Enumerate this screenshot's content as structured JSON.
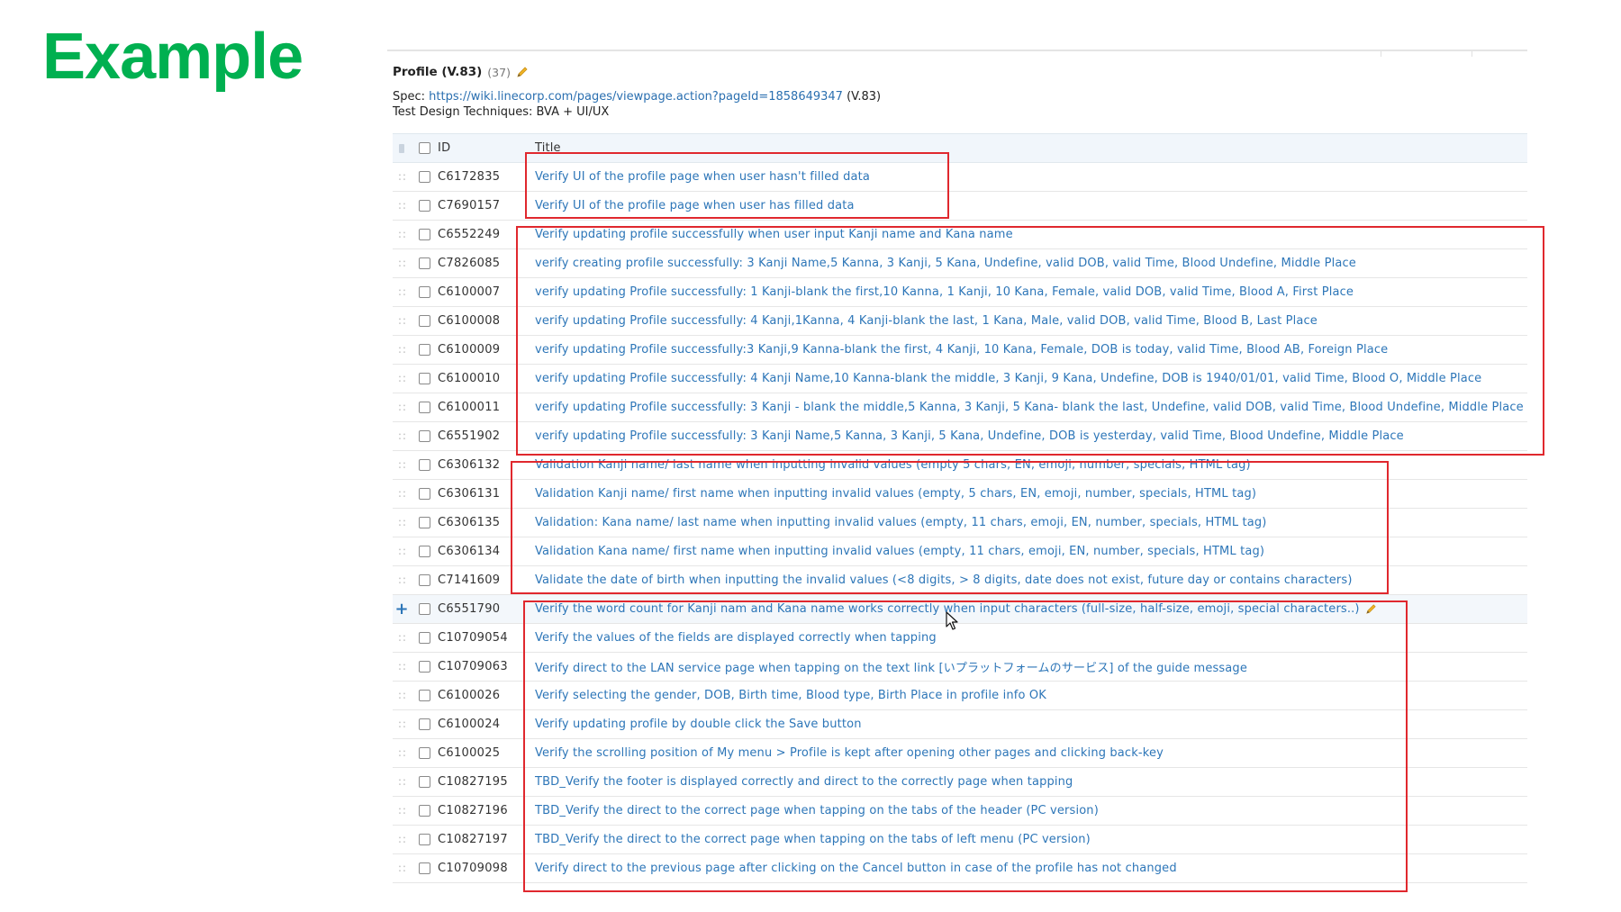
{
  "slide": {
    "title": "Example"
  },
  "section": {
    "name": "Profile (V.83)",
    "count": "(37)",
    "spec_label": "Spec:",
    "spec_url": "https://wiki.linecorp.com/pages/viewpage.action?pageId=1858649347",
    "spec_version": "(V.83)",
    "techniques": "Test Design Techniques: BVA + UI/UX"
  },
  "table": {
    "columns": {
      "id": "ID",
      "title": "Title"
    },
    "rows": [
      {
        "id": "C6172835",
        "title": "Verify UI of the profile page when user hasn't filled data"
      },
      {
        "id": "C7690157",
        "title": "Verify UI of the profile page when user has filled data"
      },
      {
        "id": "C6552249",
        "title": "Verify updating profile successfully when user input Kanji name and Kana name"
      },
      {
        "id": "C7826085",
        "title": "verify creating profile successfully: 3 Kanji Name,5 Kanna, 3 Kanji, 5 Kana, Undefine, valid DOB, valid Time, Blood Undefine, Middle Place"
      },
      {
        "id": "C6100007",
        "title": "verify updating Profile successfully: 1 Kanji-blank the first,10 Kanna, 1 Kanji, 10 Kana, Female, valid DOB, valid Time, Blood A, First Place"
      },
      {
        "id": "C6100008",
        "title": "verify updating Profile successfully: 4 Kanji,1Kanna, 4 Kanji-blank the last, 1 Kana, Male, valid DOB, valid Time, Blood B, Last Place"
      },
      {
        "id": "C6100009",
        "title": "verify updating Profile successfully:3 Kanji,9 Kanna-blank the first, 4 Kanji, 10 Kana, Female, DOB is today, valid Time, Blood AB, Foreign Place"
      },
      {
        "id": "C6100010",
        "title": "verify updating Profile successfully: 4 Kanji Name,10 Kanna-blank the middle, 3 Kanji, 9 Kana, Undefine, DOB is 1940/01/01, valid Time, Blood O, Middle Place"
      },
      {
        "id": "C6100011",
        "title": "verify updating Profile successfully: 3 Kanji - blank the middle,5 Kanna, 3 Kanji, 5 Kana- blank the last, Undefine, valid DOB, valid Time, Blood Undefine, Middle Place"
      },
      {
        "id": "C6551902",
        "title": "verify updating Profile successfully: 3 Kanji Name,5 Kanna, 3 Kanji, 5 Kana, Undefine, DOB is yesterday, valid Time, Blood Undefine, Middle Place"
      },
      {
        "id": "C6306132",
        "title": "Validation Kanji name/ last name when inputting invalid values (empty 5 chars, EN, emoji, number, specials, HTML tag)"
      },
      {
        "id": "C6306131",
        "title": "Validation Kanji name/ first name when inputting invalid values (empty, 5 chars, EN, emoji, number, specials, HTML tag)"
      },
      {
        "id": "C6306135",
        "title": "Validation: Kana name/ last name when inputting invalid values (empty, 11 chars, emoji, EN, number, specials, HTML tag)"
      },
      {
        "id": "C6306134",
        "title": "Validation Kana name/ first name when inputting invalid values (empty, 11 chars, emoji, EN, number, specials, HTML tag)"
      },
      {
        "id": "C7141609",
        "title": "Validate the date of birth when inputting the invalid values (<8 digits, > 8 digits, date does not exist, future day or contains characters)"
      },
      {
        "id": "C6551790",
        "title": "Verify the word count for Kanji nam and Kana name works correctly when input characters (full-size, half-size, emoji, special characters..)"
      },
      {
        "id": "C10709054",
        "title": "Verify the values of the fields are displayed correctly when tapping"
      },
      {
        "id": "C10709063",
        "title": "Verify direct to the LAN service page when tapping on the text link [いプラットフォームのサービス] of the guide message"
      },
      {
        "id": "C6100026",
        "title": "Verify selecting the gender, DOB, Birth time, Blood type, Birth Place in profile info OK"
      },
      {
        "id": "C6100024",
        "title": "Verify updating profile by double click the Save button"
      },
      {
        "id": "C6100025",
        "title": "Verify the scrolling position of My menu > Profile is kept after opening other pages and clicking back-key"
      },
      {
        "id": "C10827195",
        "title": "TBD_Verify the footer is displayed correctly and direct to the correctly page when tapping"
      },
      {
        "id": "C10827196",
        "title": "TBD_Verify the direct to the correct page when tapping on the tabs of the header (PC version)"
      },
      {
        "id": "C10827197",
        "title": "TBD_Verify the direct to the correct page when tapping on the tabs of left menu (PC version)"
      },
      {
        "id": "C10709098",
        "title": "Verify direct to the previous page after clicking on the Cancel button in case of the profile has not changed"
      }
    ]
  },
  "colors": {
    "heading_green": "#00b050",
    "link_blue": "#2d76b8",
    "highlight_red": "#e0282e"
  }
}
